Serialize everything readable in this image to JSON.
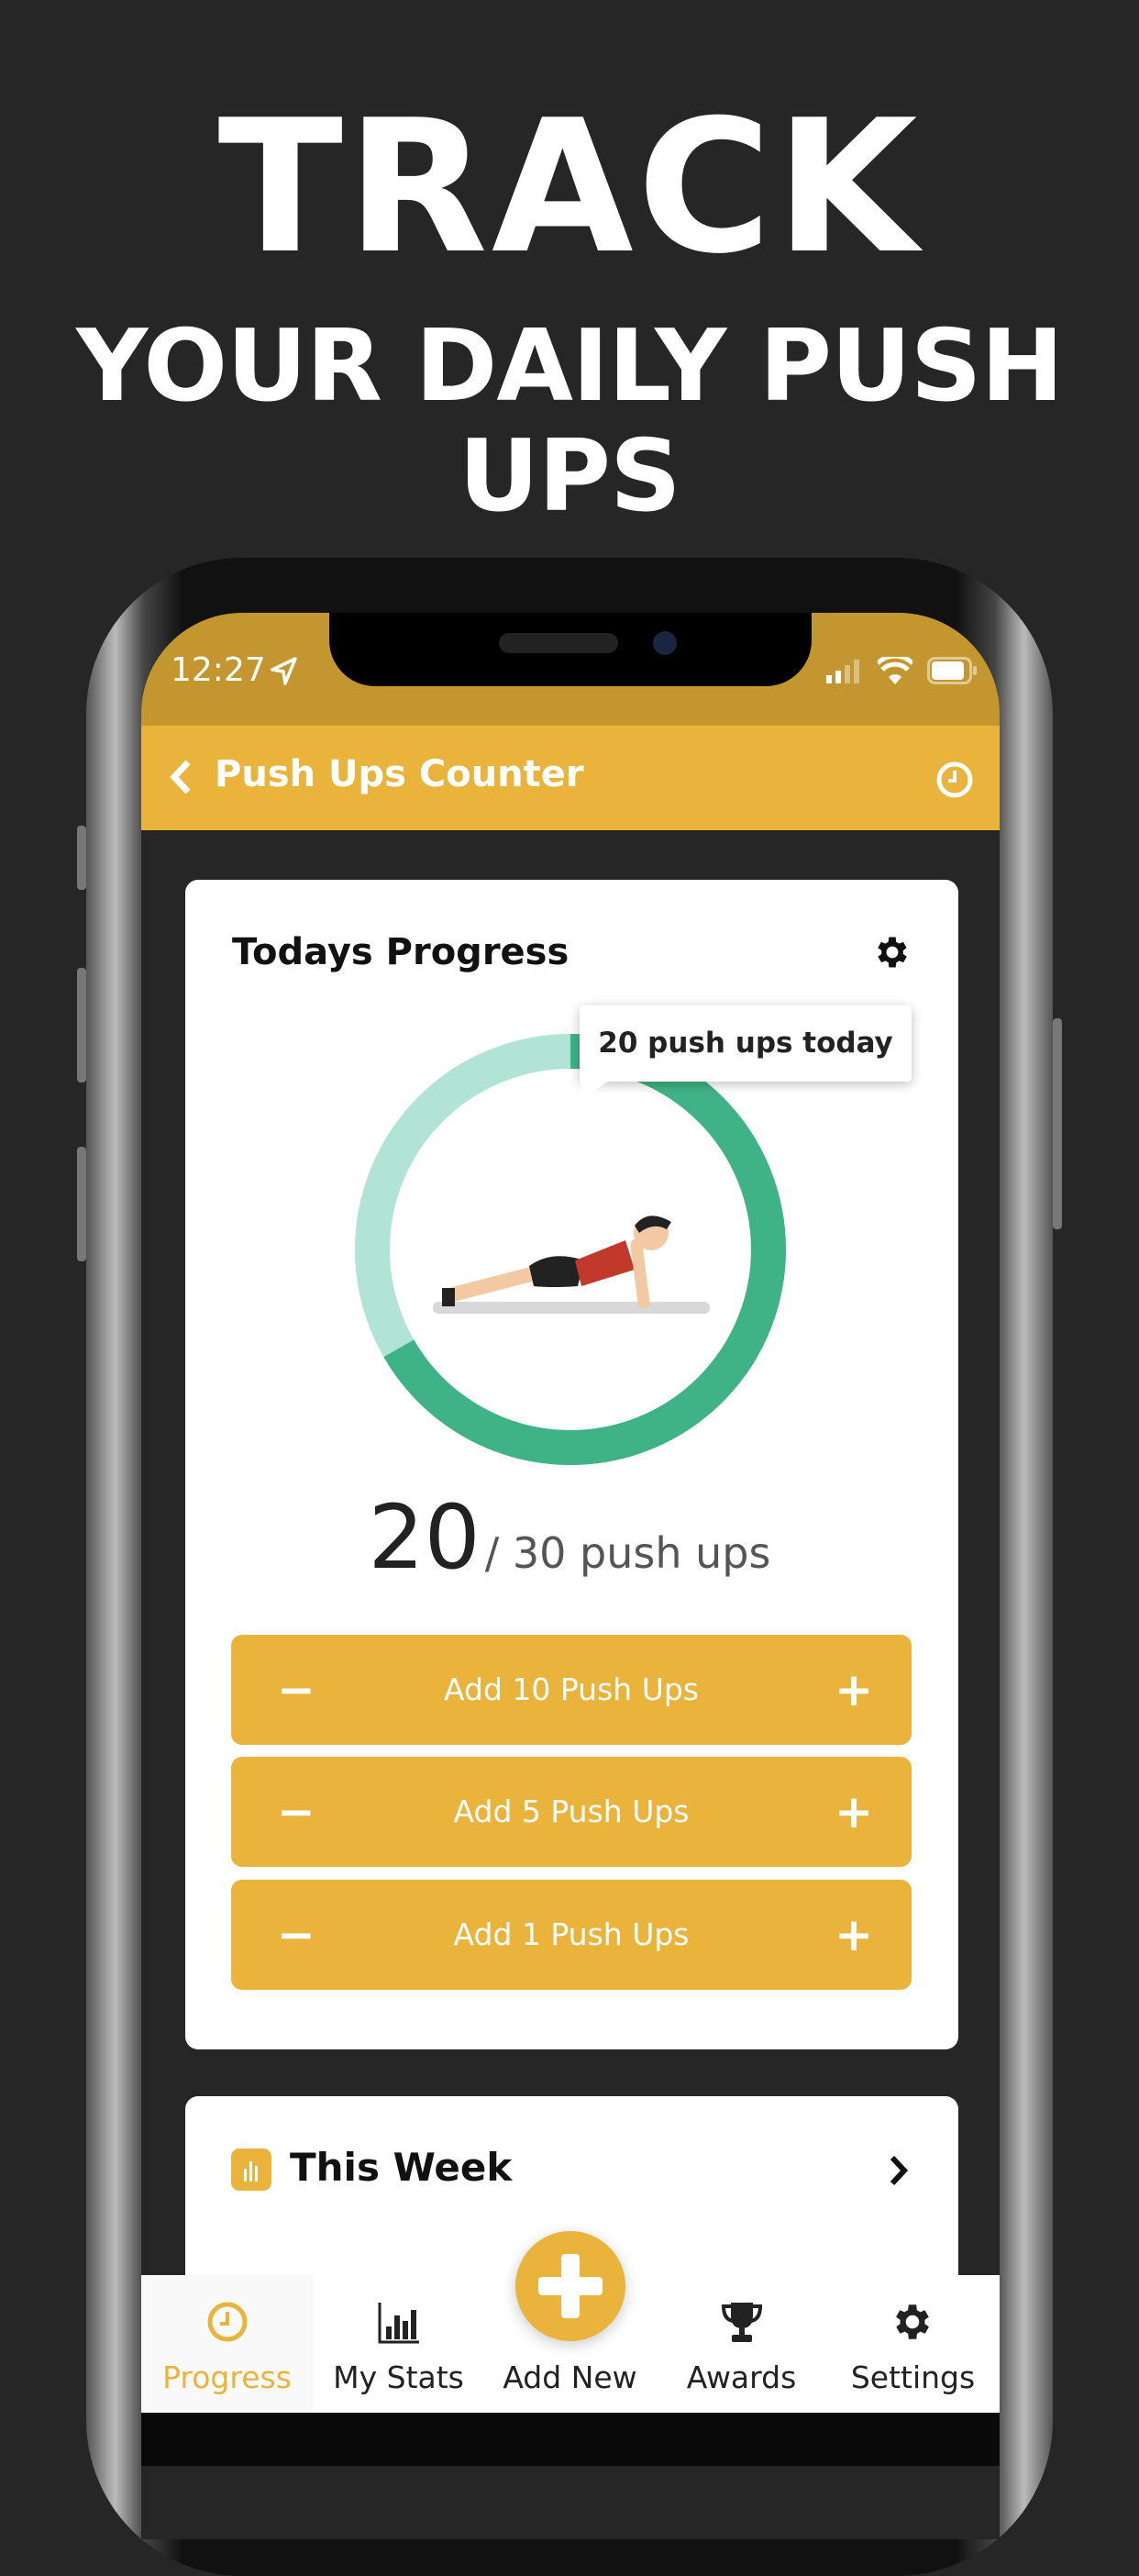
{
  "headline": {
    "line1": "TRACK",
    "line2": "YOUR DAILY PUSH UPS"
  },
  "status_bar": {
    "time": "12:27"
  },
  "nav": {
    "title": "Push Ups Counter",
    "back_icon": "chevron-left-icon",
    "right_icon": "clock-icon"
  },
  "progress_card": {
    "title": "Todays Progress",
    "tooltip": "20 push ups today",
    "count": "20",
    "goal_text": "/ 30 push ups",
    "current": 20,
    "goal": 30,
    "buttons": [
      {
        "label": "Add 10 Push Ups"
      },
      {
        "label": "Add 5 Push Ups"
      },
      {
        "label": "Add 1 Push Ups"
      }
    ]
  },
  "week_card": {
    "title": "This Week"
  },
  "tabs": [
    {
      "label": "Progress",
      "icon": "clock-icon",
      "active": true
    },
    {
      "label": "My Stats",
      "icon": "bar-chart-icon"
    },
    {
      "label": "Add New",
      "icon": "plus-icon"
    },
    {
      "label": "Awards",
      "icon": "trophy-icon"
    },
    {
      "label": "Settings",
      "icon": "gear-icon"
    }
  ],
  "colors": {
    "accent": "#e9b33c",
    "status": "#c4962f",
    "ring_done": "#3fb385",
    "ring_remaining": "#b1e4d4",
    "background": "#262626"
  }
}
